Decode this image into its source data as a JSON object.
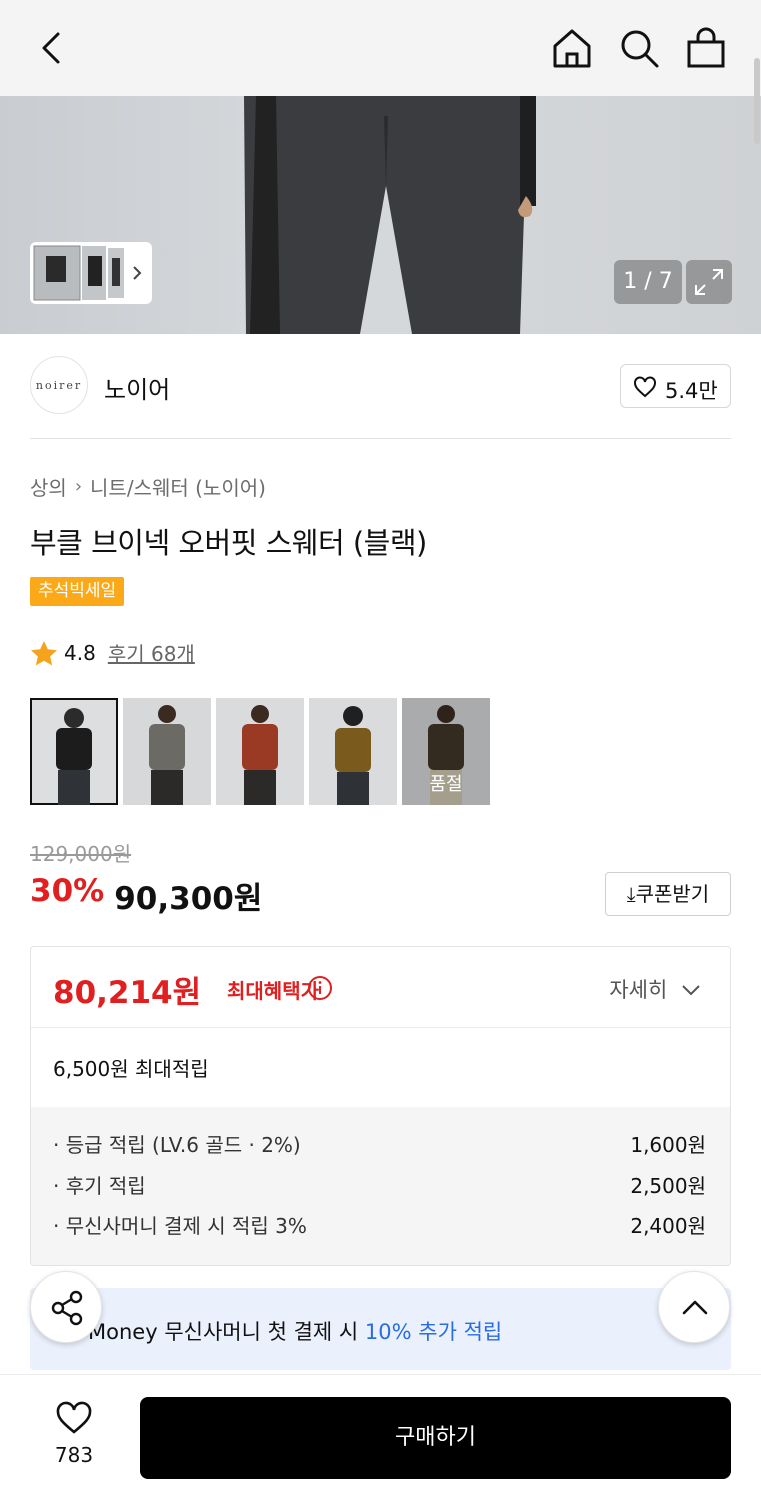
{
  "hero": {
    "counter": "1 / 7"
  },
  "brand": {
    "logo_text": "noirer",
    "name": "노이어",
    "likes": "5.4만"
  },
  "breadcrumb": {
    "category": "상의",
    "subcategory": "니트/스웨터 (노이어)"
  },
  "product": {
    "title": "부클 브이넥 오버핏 스웨터 (블랙)",
    "badge": "추석빅세일",
    "rating": "4.8",
    "reviews": "후기 68개",
    "soldout_label": "품절"
  },
  "price": {
    "original": "129,000원",
    "discount": "30%",
    "sale": "90,300원",
    "coupon_label": "쿠폰받기"
  },
  "benefit": {
    "max_price": "80,214원",
    "max_label": "최대혜택가",
    "detail_label": "자세히",
    "points_title": "6,500원 최대적립",
    "items": [
      {
        "label": "· 등급 적립 (LV.6 골드 · 2%)",
        "value": "1,600원"
      },
      {
        "label": "· 후기 적립",
        "value": "2,500원"
      },
      {
        "label": "· 무신사머니 결제 시 적립 3%",
        "value": "2,400원"
      }
    ]
  },
  "money_banner": {
    "prefix": "Money",
    "text": "무신사머니 첫 결제 시",
    "highlight": "10% 추가 적립"
  },
  "bottom": {
    "wish_count": "783",
    "buy_label": "구매하기"
  },
  "colors": {
    "accent_red": "#e02020",
    "badge_orange": "#fba919",
    "money_blue": "#2a6de0"
  }
}
